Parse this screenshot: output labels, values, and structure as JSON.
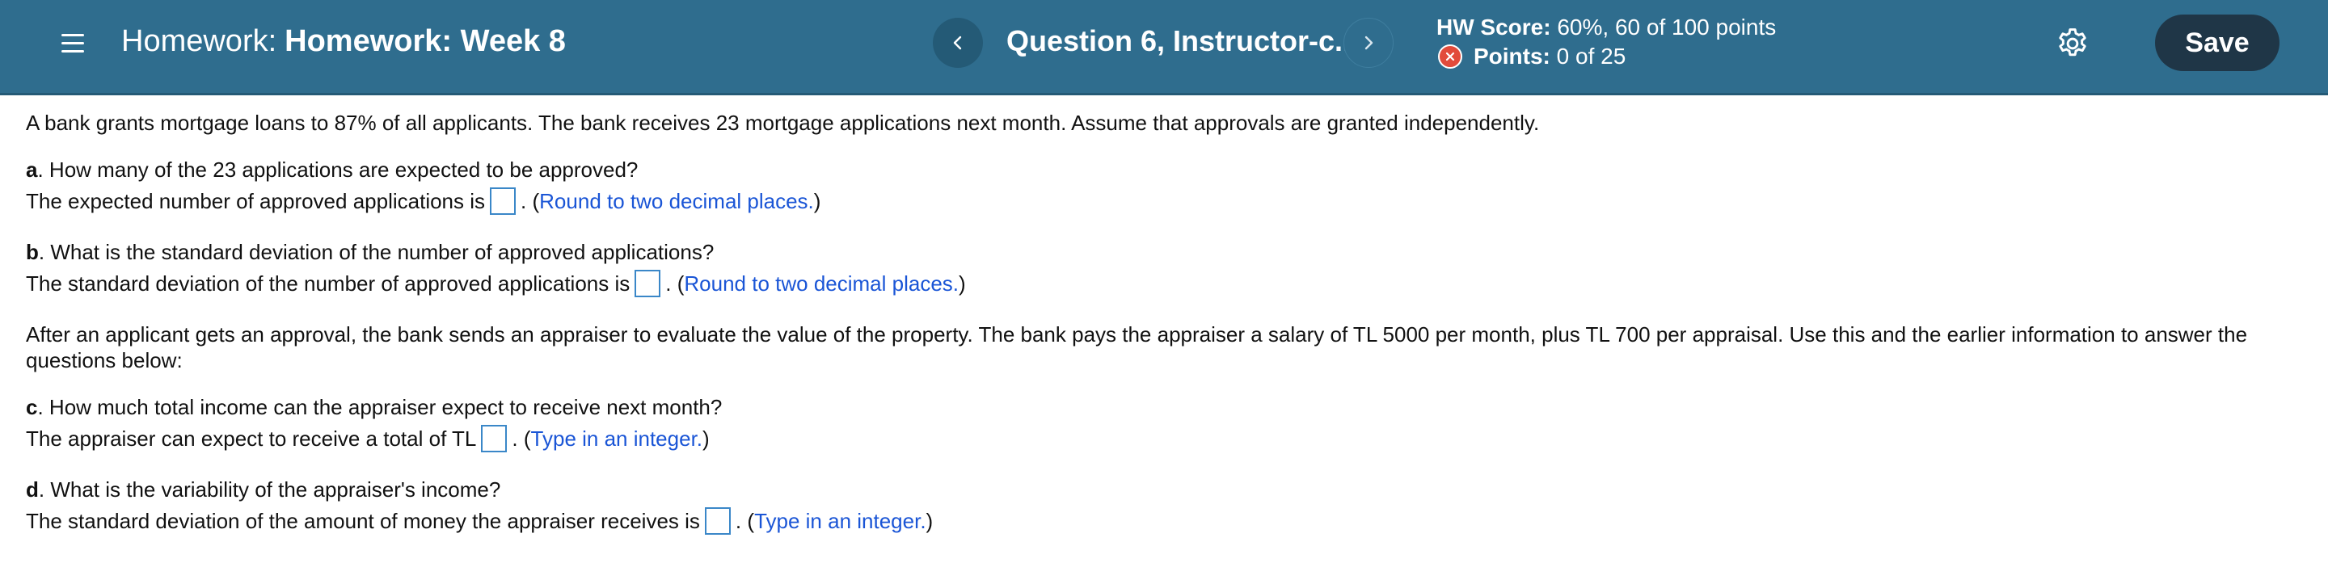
{
  "header": {
    "title_prefix": "Homework:",
    "title_name": "Homework: Week 8",
    "question_label": "Question 6, Instructor-c...",
    "hw_score_label": "HW Score:",
    "hw_score_value": "60%, 60 of 100 points",
    "points_label": "Points:",
    "points_value": "0 of 25",
    "save_label": "Save"
  },
  "content": {
    "intro": "A bank grants mortgage loans to 87% of all applicants. The bank receives 23 mortgage applications next month. Assume that approvals are granted independently.",
    "a": {
      "letter": "a",
      "question": ". How many of the 23 applications are expected to be approved?",
      "answer_prefix": "The expected number of approved applications is",
      "answer_suffix": ".",
      "hint": "Round to two decimal places."
    },
    "b": {
      "letter": "b",
      "question": ". What is the standard deviation of the number of approved applications?",
      "answer_prefix": "The standard deviation of the number of approved applications is",
      "answer_suffix": ".",
      "hint": "Round to two decimal places."
    },
    "context": "After an applicant gets an approval, the bank sends an appraiser to evaluate the value of the property. The bank pays the appraiser a salary of TL 5000 per month, plus TL 700 per appraisal. Use this and the earlier information to answer the questions below:",
    "c": {
      "letter": "c",
      "question": ". How much total income can the appraiser expect to receive next month?",
      "answer_prefix": "The appraiser can expect to receive a total of TL",
      "answer_suffix": ".",
      "hint": "Type in an integer."
    },
    "d": {
      "letter": "d",
      "question": ". What is the variability of the appraiser's income?",
      "answer_prefix": "The standard deviation of the amount of money the appraiser receives is",
      "answer_suffix": ".",
      "hint": "Type in an integer."
    }
  },
  "icons": {
    "menu": "hamburger-menu-icon",
    "prev": "chevron-left-icon",
    "next": "chevron-right-icon",
    "points_status": "incorrect-x-icon",
    "settings": "gear-icon"
  },
  "colors": {
    "header_bg": "#2f6d8e",
    "save_bg": "#1f3647",
    "hint": "#1a55d6",
    "error": "#e24b3b"
  }
}
